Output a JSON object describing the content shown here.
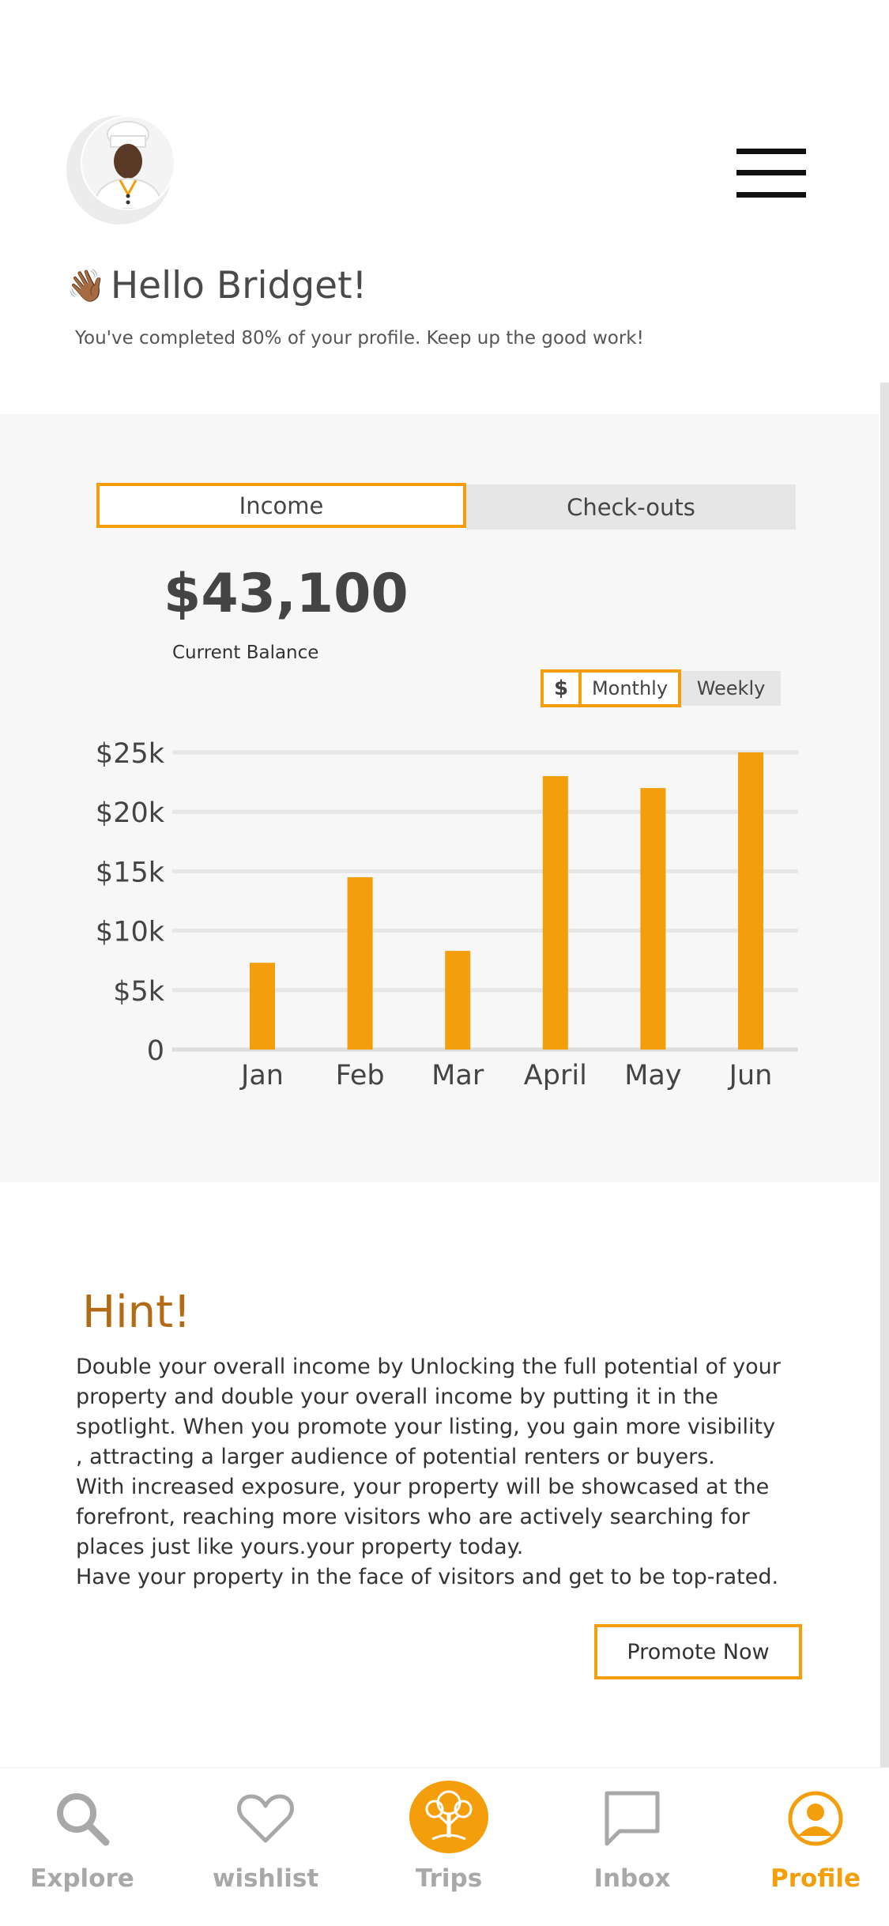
{
  "header": {
    "menu_icon": "hamburger-menu-icon",
    "avatar_icon": "chef-avatar-icon"
  },
  "greeting": {
    "wave": "👋🏾",
    "text": "Hello Bridget!",
    "subtitle": "You've completed 80% of your profile. Keep up the good work!",
    "profile_completion_percent": 80
  },
  "tabs": {
    "income": "Income",
    "checkouts": "Check-outs",
    "active": "Income"
  },
  "balance": {
    "amount": "$43,100",
    "label": "Current Balance"
  },
  "toggle": {
    "currency": "$",
    "monthly": "Monthly",
    "weekly": "Weekly",
    "active": "Monthly"
  },
  "chart_data": {
    "type": "bar",
    "categories": [
      "Jan",
      "Feb",
      "Mar",
      "April",
      "May",
      "Jun"
    ],
    "values": [
      7300,
      14500,
      8300,
      23000,
      22000,
      25000
    ],
    "yticks": [
      "0",
      "$5k",
      "$10k",
      "$15k",
      "$20k",
      "$25k"
    ],
    "ytick_values": [
      0,
      5000,
      10000,
      15000,
      20000,
      25000
    ],
    "ylim": [
      0,
      25000
    ],
    "grid": true,
    "bar_color": "#f59e0b",
    "title": "",
    "xlabel": "",
    "ylabel": ""
  },
  "hint": {
    "title": "Hint!",
    "lines": [
      "Double your overall income by Unlocking the full potential of your",
      "property and double your overall income by putting it in the",
      "spotlight. When you promote your listing, you gain more visibility",
      ", attracting a larger audience of potential renters or buyers.",
      "With increased exposure, your property will be showcased at the",
      " forefront, reaching more visitors who are actively searching for",
      "places just like yours.your property today.",
      "Have your property in the face of visitors and get to be top-rated."
    ],
    "button": "Promote Now"
  },
  "nav": {
    "items": [
      {
        "label": "Explore",
        "icon": "search-icon"
      },
      {
        "label": "wishlist",
        "icon": "heart-icon"
      },
      {
        "label": "Trips",
        "icon": "tree-logo-icon"
      },
      {
        "label": "Inbox",
        "icon": "chat-bubble-icon"
      },
      {
        "label": "Profile",
        "icon": "profile-icon"
      }
    ],
    "active": "Profile"
  },
  "colors": {
    "accent": "#f59e0b",
    "hint_title": "#b46a14",
    "inactive_nav": "#a8a8a8"
  }
}
